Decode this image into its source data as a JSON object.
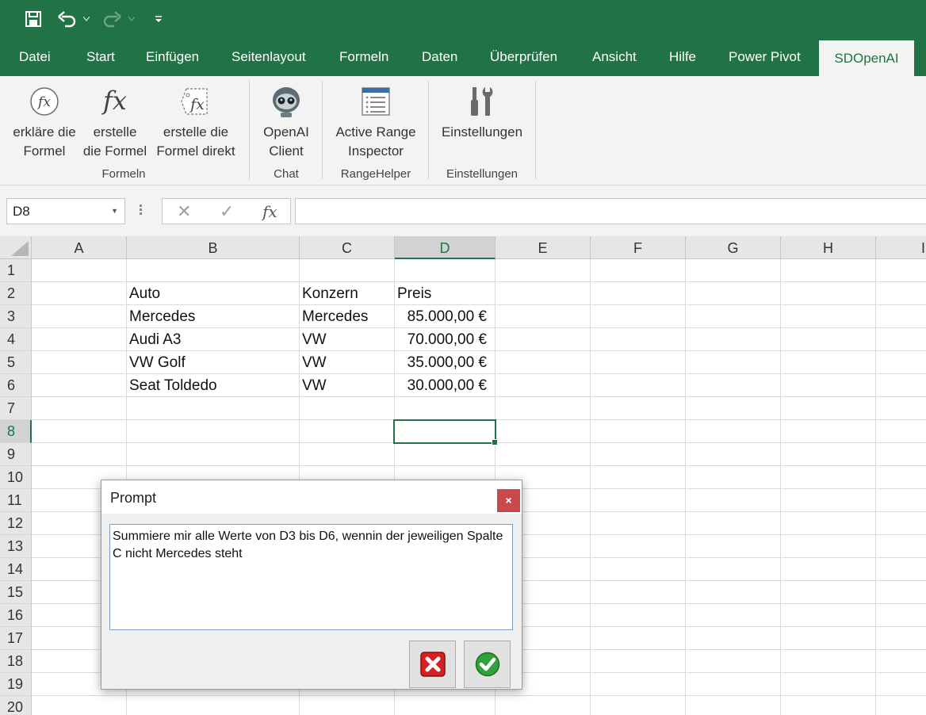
{
  "ribbon_tabs": [
    "Datei",
    "Start",
    "Einfügen",
    "Seitenlayout",
    "Formeln",
    "Daten",
    "Überprüfen",
    "Ansicht",
    "Hilfe",
    "Power Pivot",
    "SDOpenAI"
  ],
  "active_tab": "SDOpenAI",
  "ribbon": {
    "buttons": [
      {
        "label": "erkläre die\nFormel",
        "icon": "fx-circle-icon"
      },
      {
        "label": "erstelle\ndie Formel",
        "icon": "fx-icon"
      },
      {
        "label": "erstelle die\nFormel direkt",
        "icon": "fx-tag-icon"
      },
      {
        "label": "OpenAI\nClient",
        "icon": "robot-icon"
      },
      {
        "label": "Active Range\nInspector",
        "icon": "list-window-icon"
      },
      {
        "label": "Einstellungen",
        "icon": "tools-icon"
      }
    ],
    "groups": [
      "Formeln",
      "Chat",
      "RangeHelper",
      "Einstellungen"
    ]
  },
  "formula_bar": {
    "name_box": "D8",
    "cancel_glyph": "✕",
    "enter_glyph": "✓",
    "fx_glyph": "fx",
    "formula": ""
  },
  "sheet": {
    "columns": [
      "A",
      "B",
      "C",
      "D",
      "E",
      "F",
      "G",
      "H",
      "I"
    ],
    "rows": [
      "1",
      "2",
      "3",
      "4",
      "5",
      "6",
      "7",
      "8",
      "9",
      "10",
      "11",
      "12",
      "13",
      "14",
      "15",
      "16",
      "17",
      "18",
      "19",
      "20"
    ],
    "selected_column": "D",
    "selected_row": "8",
    "cells": {
      "B2": "Auto",
      "C2": "Konzern",
      "D2": "Preis",
      "B3": "Mercedes",
      "C3": "Mercedes",
      "D3": "85.000,00 €",
      "B4": "Audi A3",
      "C4": "VW",
      "D4": "70.000,00 €",
      "B5": "VW Golf",
      "C5": "VW",
      "D5": "35.000,00 €",
      "B6": "Seat Toldedo",
      "C6": "VW",
      "D6": "30.000,00 €"
    }
  },
  "dialog": {
    "title": "Prompt",
    "close_glyph": "×",
    "prompt_text": "Summiere mir alle Werte von D3 bis D6, wennin der jeweiligen Spalte C nicht Mercedes steht",
    "cancel_icon": "red-x-icon",
    "ok_icon": "green-check-icon"
  },
  "colors": {
    "excel_green": "#217346",
    "ribbon_bg": "#f3f3f3",
    "close_red": "#c84a4a"
  }
}
